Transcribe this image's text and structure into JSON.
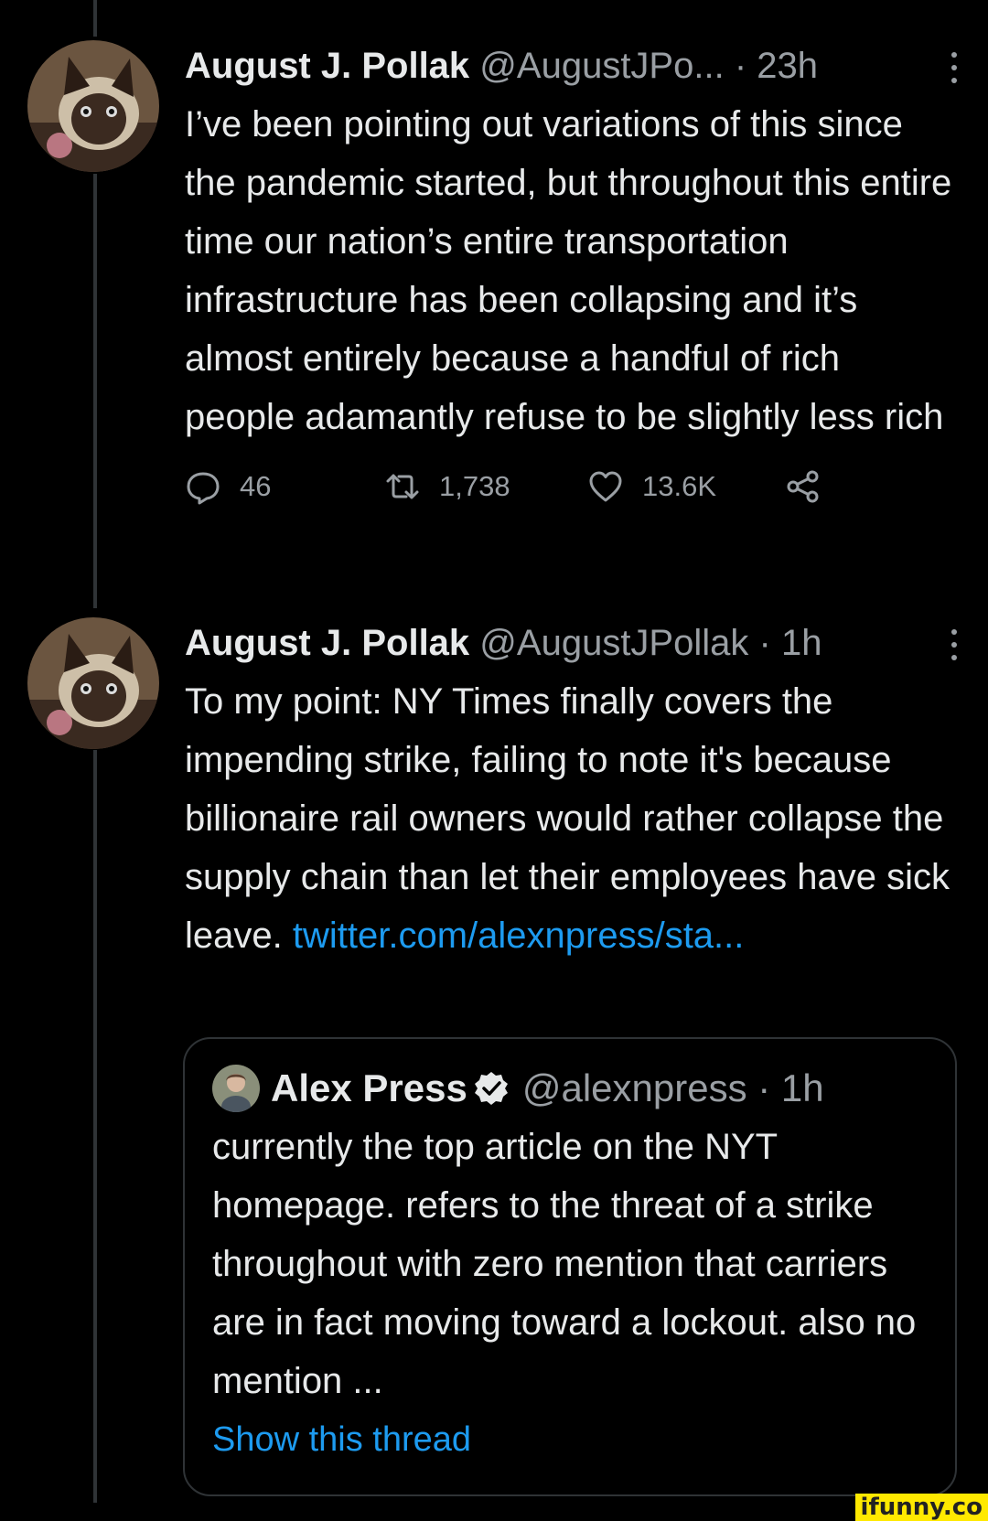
{
  "tweets": [
    {
      "name": "August J. Pollak",
      "handle": "@AugustJPo...",
      "separator": "·",
      "time": "23h",
      "text": "I’ve been pointing out variations of this since the pandemic started, but throughout this entire time our nation’s entire transportation infrastructure has been collapsing and it’s almost entirely because a handful of rich people adamantly refuse to be slightly less rich",
      "replies": "46",
      "retweets": "1,738",
      "likes": "13.6K"
    },
    {
      "name": "August J. Pollak",
      "handle": "@AugustJPollak",
      "separator": "·",
      "time": "1h",
      "text": "To my point: NY Times finally covers the impending strike, failing to note it's because billionaire rail owners would rather collapse the supply chain than let their employees have sick leave.",
      "link": "twitter.com/alexnpress/sta..."
    }
  ],
  "quote": {
    "name": "Alex Press",
    "handle": "@alexnpress",
    "separator": "·",
    "time": "1h",
    "text": "currently the top article on the NYT homepage. refers to the threat of a strike throughout with zero mention that carriers are in fact moving toward a lockout. also no mention ...",
    "show_thread": "Show this thread"
  },
  "watermark": "ifunny.co",
  "colors": {
    "background": "#000000",
    "text": "#e7e9ea",
    "secondary": "#9a9fa4",
    "link": "#1d9bf0",
    "border": "#2f3336"
  }
}
